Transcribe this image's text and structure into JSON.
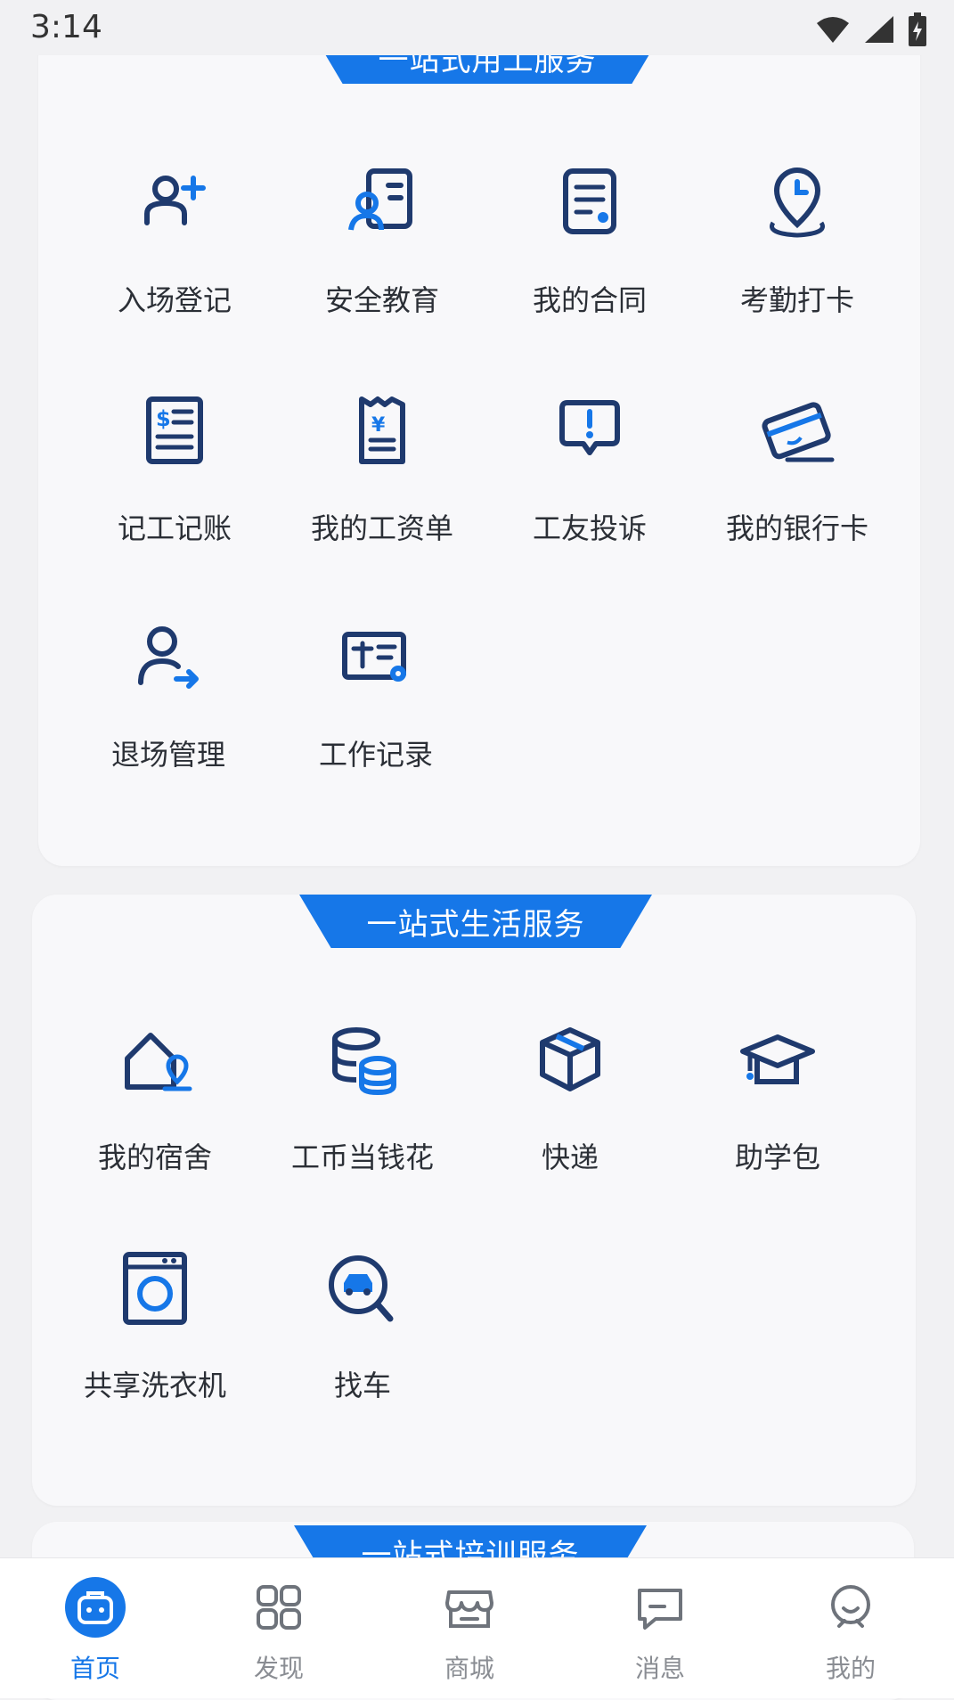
{
  "status": {
    "time": "3:14"
  },
  "sections": [
    {
      "title": "一站式用工服务",
      "items": [
        {
          "label": "入场登记",
          "icon": "user-add-icon"
        },
        {
          "label": "安全教育",
          "icon": "safety-education-icon"
        },
        {
          "label": "我的合同",
          "icon": "contract-icon"
        },
        {
          "label": "考勤打卡",
          "icon": "location-clock-icon"
        },
        {
          "label": "记工记账",
          "icon": "ledger-icon"
        },
        {
          "label": "我的工资单",
          "icon": "payslip-icon"
        },
        {
          "label": "工友投诉",
          "icon": "complaint-icon"
        },
        {
          "label": "我的银行卡",
          "icon": "bank-card-icon"
        },
        {
          "label": "退场管理",
          "icon": "user-exit-icon"
        },
        {
          "label": "工作记录",
          "icon": "work-record-icon"
        }
      ]
    },
    {
      "title": "一站式生活服务",
      "items": [
        {
          "label": "我的宿舍",
          "icon": "dorm-icon"
        },
        {
          "label": "工币当钱花",
          "icon": "coins-icon"
        },
        {
          "label": "快递",
          "icon": "package-icon"
        },
        {
          "label": "助学包",
          "icon": "graduation-cap-icon"
        },
        {
          "label": "共享洗衣机",
          "icon": "washing-machine-icon"
        },
        {
          "label": "找车",
          "icon": "car-search-icon"
        }
      ]
    },
    {
      "title": "一站式培训服务",
      "items": []
    }
  ],
  "tabs": [
    {
      "label": "首页",
      "icon": "home-bag-icon",
      "active": true
    },
    {
      "label": "发现",
      "icon": "grid-icon",
      "active": false
    },
    {
      "label": "商城",
      "icon": "store-icon",
      "active": false
    },
    {
      "label": "消息",
      "icon": "message-icon",
      "active": false
    },
    {
      "label": "我的",
      "icon": "profile-icon",
      "active": false
    }
  ],
  "colors": {
    "accent": "#1677e8",
    "icon_dark": "#1f3a6e",
    "card": "#f8f8fa"
  }
}
